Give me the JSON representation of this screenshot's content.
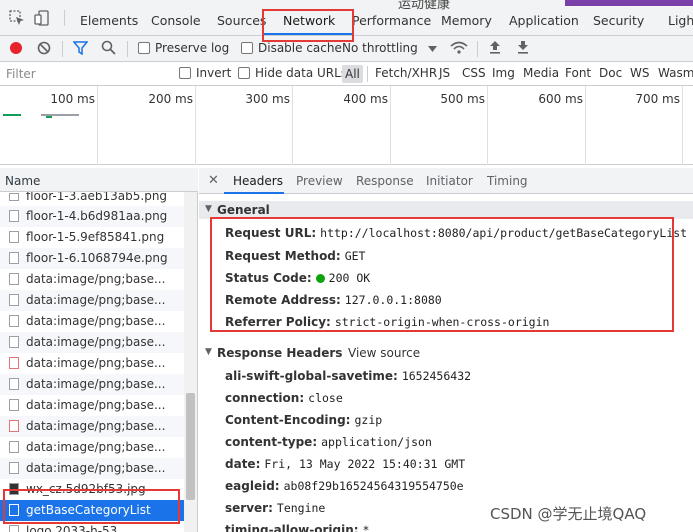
{
  "devtools": {
    "tabs": [
      {
        "label": "Elements"
      },
      {
        "label": "Console"
      },
      {
        "label": "Sources"
      },
      {
        "label": "Network"
      },
      {
        "label": "Performance"
      },
      {
        "label": "Memory"
      },
      {
        "label": "Application"
      },
      {
        "label": "Security"
      },
      {
        "label": "Light"
      }
    ],
    "active_tab": "Network",
    "peek_text": "运动健康",
    "accent_color": "#1a73e8",
    "highlight_color": "#e53935"
  },
  "toolbar": {
    "preserve_log": "Preserve log",
    "disable_cache": "Disable cache",
    "throttling": "No throttling"
  },
  "filter": {
    "placeholder": "Filter",
    "invert": "Invert",
    "hide_data_urls": "Hide data URLs",
    "types": [
      "All",
      "Fetch/XHR",
      "JS",
      "CSS",
      "Img",
      "Media",
      "Font",
      "Doc",
      "WS",
      "Wasm"
    ]
  },
  "timeline": {
    "ticks": [
      "100 ms",
      "200 ms",
      "300 ms",
      "400 ms",
      "500 ms",
      "600 ms",
      "700 ms"
    ]
  },
  "requests": {
    "header": "Name",
    "rows": [
      "floor-1-3.aeb13ab5.png",
      "floor-1-4.b6d981aa.png",
      "floor-1-5.9ef85841.png",
      "floor-1-6.1068794e.png",
      "data:image/png;base...",
      "data:image/png;base...",
      "data:image/png;base...",
      "data:image/png;base...",
      "data:image/png;base...",
      "data:image/png;base...",
      "data:image/png;base...",
      "data:image/png;base...",
      "data:image/png;base...",
      "data:image/png;base...",
      "wx_cz.5d92bf53.jpg",
      "getBaseCategoryList",
      "logo.2033-h-53..."
    ],
    "selected": "getBaseCategoryList"
  },
  "detail": {
    "tabs": [
      "Headers",
      "Preview",
      "Response",
      "Initiator",
      "Timing"
    ],
    "general": {
      "title": "General",
      "request_url_label": "Request URL:",
      "request_url": "http://localhost:8080/api/product/getBaseCategoryList",
      "method_label": "Request Method:",
      "method": "GET",
      "status_label": "Status Code:",
      "status": "200 OK",
      "status_color": "#0ca30c",
      "remote_label": "Remote Address:",
      "remote": "127.0.0.1:8080",
      "referrer_label": "Referrer Policy:",
      "referrer": "strict-origin-when-cross-origin"
    },
    "response_headers": {
      "title": "Response Headers",
      "view_source": "View source",
      "items": [
        {
          "k": "ali-swift-global-savetime:",
          "v": "1652456432"
        },
        {
          "k": "connection:",
          "v": "close"
        },
        {
          "k": "Content-Encoding:",
          "v": "gzip"
        },
        {
          "k": "content-type:",
          "v": "application/json"
        },
        {
          "k": "date:",
          "v": "Fri, 13 May 2022 15:40:31 GMT"
        },
        {
          "k": "eagleid:",
          "v": "ab08f29b16524564319554750e"
        },
        {
          "k": "server:",
          "v": "Tengine"
        },
        {
          "k": "timing-allow-origin:",
          "v": "*"
        }
      ]
    }
  },
  "watermark": "CSDN @学无止境QAQ"
}
